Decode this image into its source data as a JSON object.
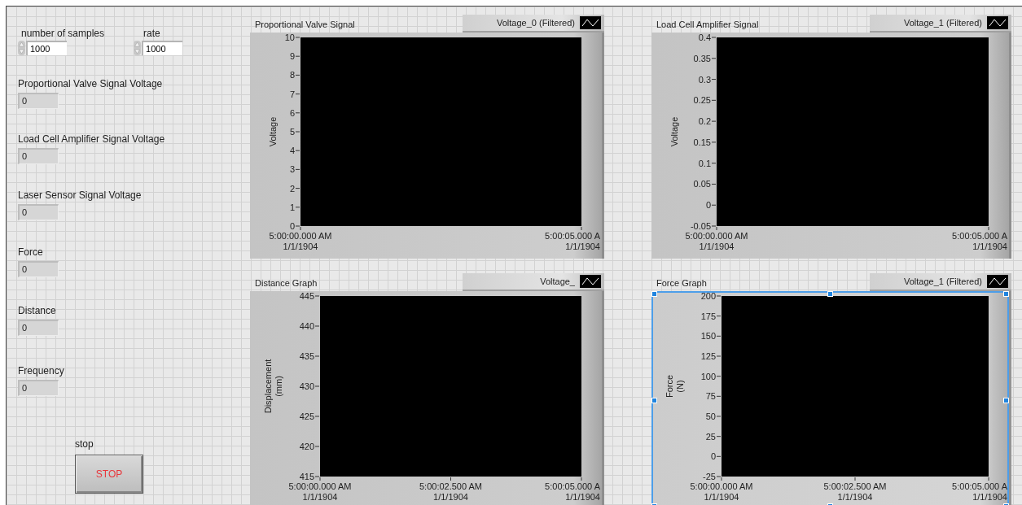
{
  "controls": [
    {
      "label": "number of samples",
      "value": "1000"
    },
    {
      "label": "rate",
      "value": "1000"
    }
  ],
  "indicators": [
    {
      "label": "Proportional Valve Signal Voltage",
      "value": "0"
    },
    {
      "label": "Load Cell Amplifier Signal Voltage",
      "value": "0"
    },
    {
      "label": "Laser Sensor Signal Voltage",
      "value": "0"
    },
    {
      "label": "Force",
      "value": "0"
    },
    {
      "label": "Distance",
      "value": "0"
    },
    {
      "label": "Frequency",
      "value": "0"
    }
  ],
  "stop_button": {
    "label": "stop",
    "text": "STOP"
  },
  "graphs": [
    {
      "legend": "Voltage_0 (Filtered)",
      "selected": false,
      "chart_data": {
        "type": "line",
        "title": "Proportional Valve Signal",
        "ylabel": "Voltage",
        "ylim": [
          0,
          10
        ],
        "yticks": [
          0,
          1,
          2,
          3,
          4,
          5,
          6,
          7,
          8,
          9,
          10
        ],
        "categories": [
          "5:00:00.000 AM\n1/1/1904",
          "5:00:05.000 A\n1/1/1904"
        ]
      }
    },
    {
      "legend": "Voltage_1 (Filtered)",
      "selected": false,
      "chart_data": {
        "type": "line",
        "title": "Load Cell Amplifier Signal",
        "ylabel": "Voltage",
        "ylim": [
          -0.05,
          0.4
        ],
        "yticks": [
          {
            "value": -0.05,
            "label": "-0.05"
          },
          {
            "value": 0,
            "label": "0"
          },
          {
            "value": 0.05,
            "label": "0.05"
          },
          {
            "value": 0.1,
            "label": "0.1"
          },
          {
            "value": 0.15,
            "label": "0.15"
          },
          {
            "value": 0.2,
            "label": "0.2"
          },
          {
            "value": 0.25,
            "label": "0.25"
          },
          {
            "value": 0.3,
            "label": "0.3"
          },
          {
            "value": 0.35,
            "label": "0.35"
          },
          {
            "value": 0.4,
            "label": "0.4"
          }
        ],
        "categories": [
          "5:00:00.000 AM\n1/1/1904",
          "5:00:05.000 A\n1/1/1904"
        ]
      }
    },
    {
      "legend": "Voltage_",
      "selected": false,
      "chart_data": {
        "type": "line",
        "title": "Distance Graph",
        "ylabel": "Displacement\n(mm)",
        "ylim": [
          415,
          445
        ],
        "yticks": [
          415,
          420,
          425,
          430,
          435,
          440,
          445
        ],
        "categories": [
          "5:00:00.000 AM\n1/1/1904",
          "5:00:02.500 AM\n1/1/1904",
          "5:00:05.000 A\n1/1/1904"
        ]
      }
    },
    {
      "legend": "Voltage_1 (Filtered)",
      "selected": true,
      "chart_data": {
        "type": "line",
        "title": "Force Graph",
        "ylabel": "Force\n(N)",
        "ylim": [
          -25,
          200
        ],
        "yticks": [
          -25,
          0,
          25,
          50,
          75,
          100,
          125,
          150,
          175,
          200
        ],
        "categories": [
          "5:00:00.000 AM\n1/1/1904",
          "5:00:02.500 AM\n1/1/1904",
          "5:00:05.000 A\n1/1/1904"
        ]
      }
    }
  ]
}
